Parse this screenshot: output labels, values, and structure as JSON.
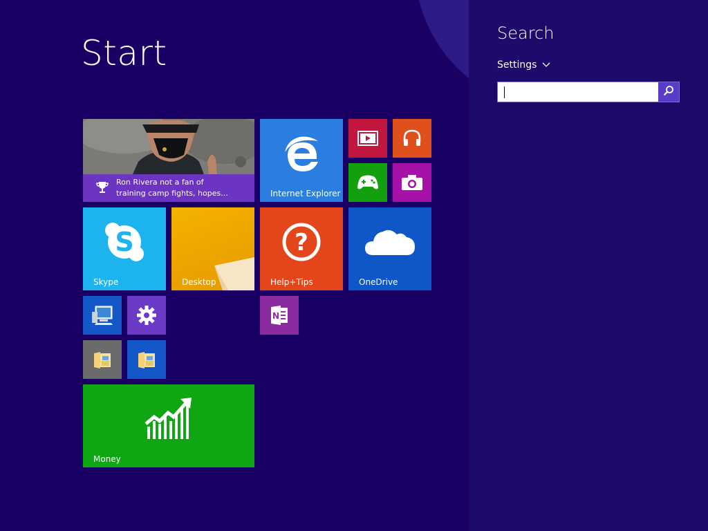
{
  "start": {
    "title": "Start"
  },
  "tiles": {
    "news": {
      "headline_line1": "Ron Rivera not a fan of",
      "headline_line2": "training camp fights, hopes..."
    },
    "internet_explorer": {
      "label": "Internet Explorer"
    },
    "skype": {
      "label": "Skype"
    },
    "desktop": {
      "label": "Desktop"
    },
    "help_tips": {
      "label": "Help+Tips"
    },
    "onedrive": {
      "label": "OneDrive"
    },
    "money": {
      "label": "Money"
    }
  },
  "search": {
    "title": "Search",
    "scope": "Settings",
    "query": "",
    "placeholder": ""
  },
  "colors": {
    "background": "#1a0064",
    "pane": "#1d0a6b",
    "news": "#6b35c2",
    "ie": "#2b7de0",
    "video": "#c1173f",
    "music": "#e0501d",
    "games": "#12a00e",
    "camera": "#a612a8",
    "skype": "#1db3ee",
    "desktop": "#f0ab00",
    "help": "#e3461a",
    "onedrive": "#0f56c8",
    "pc": "#1457c9",
    "settings": "#6a3ac7",
    "onenote": "#8a2ca0",
    "folder_gray": "#6b6b6b",
    "folder_blue": "#1457c9",
    "money": "#10a512"
  },
  "icons": [
    "trophy-icon",
    "internet-explorer-icon",
    "video-icon",
    "music-icon",
    "games-icon",
    "camera-icon",
    "skype-icon",
    "help-icon",
    "onedrive-icon",
    "computer-icon",
    "gear-icon",
    "onenote-icon",
    "folder-icon",
    "money-icon",
    "search-icon",
    "chevron-down-icon"
  ]
}
